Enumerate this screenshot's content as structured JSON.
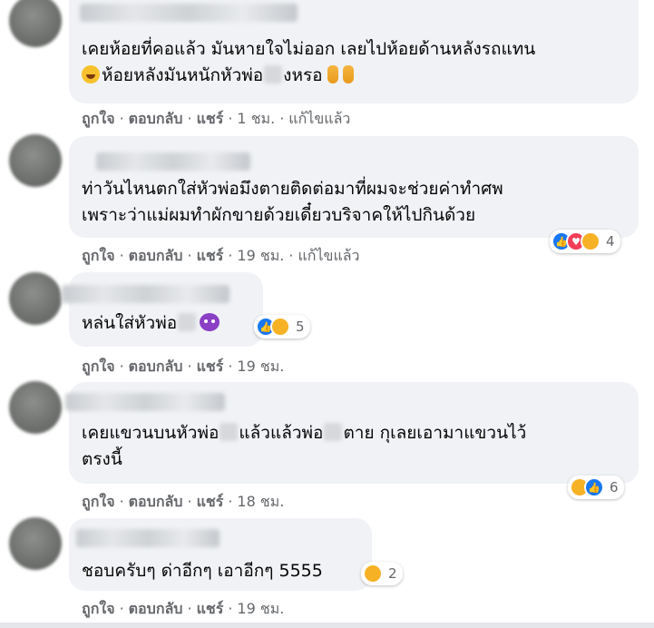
{
  "actions": {
    "like": "ถูกใจ",
    "reply": "ตอบกลับ",
    "share": "แชร์",
    "edited": "แก้ไขแล้ว"
  },
  "comments": [
    {
      "lines": [
        "เคยห้อยที่คอแล้ว มันหายใจไม่ออก เลยไปห้อยด้านหลังรถแทน",
        "ห้อยหลังมันหนักหัวพ่อ",
        "งหรอ"
      ],
      "time": "1 ชม.",
      "edited": true
    },
    {
      "lines": [
        "ท่าวันไหนตกใส่หัวพ่อมึงตายติดต่อมาที่ผมจะช่วยค่าทำศพ",
        "เพราะว่าแม่ผมทำผักขายด้วยเดี๋ยวบริจาคให้ไปกินด้วย"
      ],
      "time": "19 ชม.",
      "edited": true,
      "reaction_count": "4"
    },
    {
      "lines": [
        "หล่นใส่หัวพ่อ"
      ],
      "time": "19 ชม.",
      "reaction_count": "5"
    },
    {
      "lines": [
        "เคยแขวนบนหัวพ่อ",
        "แล้วแล้วพ่อ",
        "ตาย กุเลยเอามาแขวนไว้",
        "ตรงนี้"
      ],
      "time": "18 ชม.",
      "reaction_count": "6"
    },
    {
      "lines": [
        "ชอบครับๆ ด่าอีกๆ เอาอีกๆ 5555"
      ],
      "time": "19 ชม.",
      "reaction_count": "2"
    }
  ]
}
